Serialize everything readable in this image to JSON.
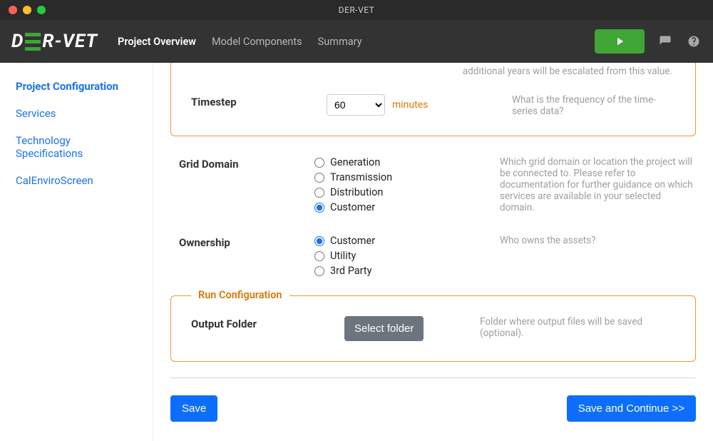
{
  "window": {
    "title": "DER-VET"
  },
  "logo": {
    "text_left": "D",
    "text_right": "R-VET"
  },
  "nav": {
    "tabs": [
      {
        "label": "Project Overview",
        "active": true
      },
      {
        "label": "Model Components",
        "active": false
      },
      {
        "label": "Summary",
        "active": false
      }
    ]
  },
  "sidebar": {
    "items": [
      {
        "label": "Project Configuration",
        "active": true
      },
      {
        "label": "Services",
        "active": false
      },
      {
        "label": "Technology Specifications",
        "active": false
      },
      {
        "label": "CalEnviroScreen",
        "active": false
      }
    ]
  },
  "first_box": {
    "partial_help": "additional years will be escalated from this value.",
    "timestep_label": "Timestep",
    "timestep_value": "60",
    "timestep_unit": "minutes",
    "timestep_help": "What is the frequency of the time-series data?"
  },
  "grid_domain": {
    "label": "Grid Domain",
    "options": [
      {
        "label": "Generation",
        "checked": false
      },
      {
        "label": "Transmission",
        "checked": false
      },
      {
        "label": "Distribution",
        "checked": false
      },
      {
        "label": "Customer",
        "checked": true
      }
    ],
    "help": "Which grid domain or location the project will be connected to. Please refer to documentation for further guidance on which services are available in your selected domain."
  },
  "ownership": {
    "label": "Ownership",
    "options": [
      {
        "label": "Customer",
        "checked": true
      },
      {
        "label": "Utility",
        "checked": false
      },
      {
        "label": "3rd Party",
        "checked": false
      }
    ],
    "help": "Who owns the assets?"
  },
  "run_config": {
    "legend": "Run Configuration",
    "output_folder_label": "Output Folder",
    "select_folder_label": "Select folder",
    "help": "Folder where output files will be saved (optional)."
  },
  "actions": {
    "save_label": "Save",
    "save_continue_label": "Save and Continue >>"
  }
}
